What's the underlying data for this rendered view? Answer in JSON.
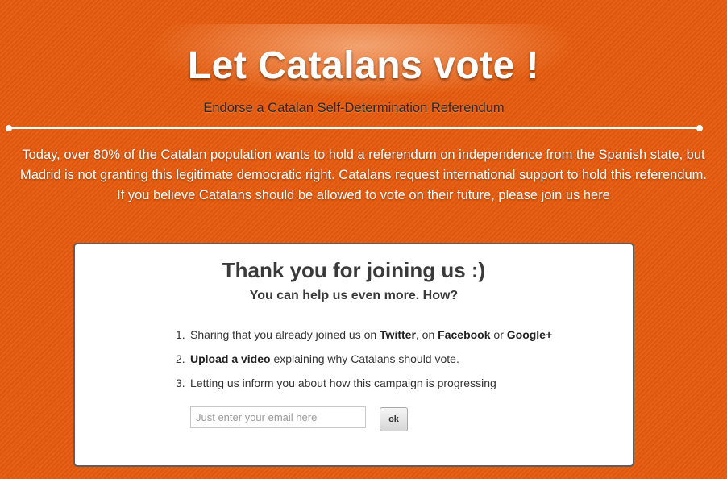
{
  "header": {
    "title": "Let Catalans vote !",
    "subtitle": "Endorse a Catalan Self-Determination Referendum"
  },
  "intro": {
    "lines": [
      "Today, over 80% of the Catalan population wants to hold a referendum on independence from the Spanish state, but",
      "Madrid is not granting this legitimate democratic right. Catalans request international support to hold this referendum.",
      "If you believe Catalans should be allowed to vote on their future, please join us here"
    ]
  },
  "panel": {
    "title": "Thank you for joining us :)",
    "subtitle": "You can help us even more. How?",
    "steps": [
      {
        "number": "1.",
        "parts": [
          "Sharing that you already joined us on ",
          "Twitter",
          ", on ",
          "Facebook",
          " or ",
          "Google+"
        ]
      },
      {
        "number": "2.",
        "parts": [
          "Upload a video",
          " explaining why Catalans should vote."
        ]
      },
      {
        "number": "3.",
        "text": "Letting us inform you about how this campaign is progressing"
      }
    ],
    "email": {
      "value": "",
      "placeholder": "Just enter your email here"
    },
    "ok_label": "ok"
  },
  "colors": {
    "background": "#e55a0c",
    "panel_border": "#5e5e5e",
    "heading_text": "#3a3a3a"
  }
}
